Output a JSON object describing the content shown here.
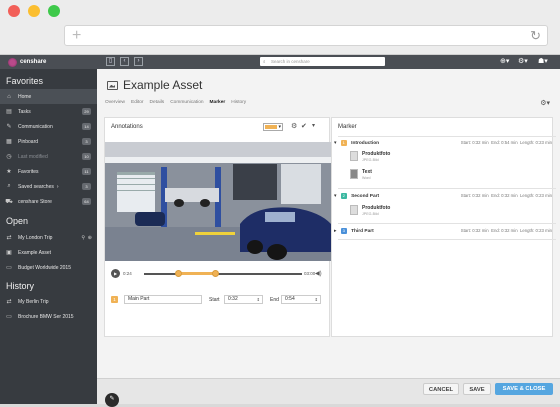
{
  "browser": {
    "colors": {
      "close": "#f25f58",
      "minimize": "#fbbe2f",
      "maximize": "#3ec94a"
    },
    "new_tab_icon": "plus-icon",
    "reload_icon": "reload-icon"
  },
  "app": {
    "brand": "censhare",
    "search_placeholder": "Search in censhare"
  },
  "sidebar": {
    "favorites_title": "Favorites",
    "favorites": [
      {
        "label": "Home",
        "icon": "home-icon",
        "badge": ""
      },
      {
        "label": "Tasks",
        "icon": "tasks-icon",
        "badge": "29"
      },
      {
        "label": "Communication",
        "icon": "communication-icon",
        "badge": "14"
      },
      {
        "label": "Pinboard",
        "icon": "pinboard-icon",
        "badge": "3"
      },
      {
        "label": "Last modified",
        "icon": "clock-icon",
        "badge": "10"
      },
      {
        "label": "Favorites",
        "icon": "star-icon",
        "badge": "11"
      },
      {
        "label": "Saved searches",
        "icon": "search-icon",
        "badge": "3"
      },
      {
        "label": "censhare Store",
        "icon": "store-icon",
        "badge": "64"
      }
    ],
    "open_title": "Open",
    "open": [
      {
        "label": "My London Trip",
        "icon": "link-icon"
      },
      {
        "label": "Example Asset",
        "icon": "image-icon"
      },
      {
        "label": "Budget Worldwide 2015",
        "icon": "document-icon"
      }
    ],
    "history_title": "History",
    "history": [
      {
        "label": "My Berlin Trip",
        "icon": "link-icon"
      },
      {
        "label": "Brochure BMW Ser 2015",
        "icon": "document-icon"
      }
    ]
  },
  "main": {
    "title": "Example Asset",
    "tabs": [
      "Overview",
      "Editor",
      "Details",
      "Communication",
      "Marker",
      "History"
    ],
    "active_tab": "Marker"
  },
  "annotations": {
    "title": "Annotations",
    "time_start": "0:24",
    "time_end": "03:00",
    "playhead_fraction": 0.45,
    "segment_start_fraction": 0.22,
    "segment_end_fraction": 0.45,
    "part_number": "1",
    "part_name": "Main Part",
    "start_label": "Start",
    "start_value": "0:32",
    "end_label": "End",
    "end_value": "0:54",
    "accent": "#f0b255"
  },
  "marker": {
    "title": "Marker",
    "parts": [
      {
        "num": "1",
        "name": "Introduction",
        "color": "#f0b255",
        "start": "Start: 0:32 min",
        "end": "End: 0:54 min",
        "length": "Length: 0:23 min",
        "items": [
          {
            "title": "Produktfoto",
            "sub": "JPEG-Bild"
          },
          {
            "title": "Text",
            "sub": "Word"
          }
        ]
      },
      {
        "num": "2",
        "name": "Second Part",
        "color": "#3bb8a1",
        "start": "Start: 0:32 min",
        "end": "End: 0:32 min",
        "length": "Length: 0:23 min",
        "items": [
          {
            "title": "Produktfoto",
            "sub": "JPEG-Bild"
          }
        ]
      },
      {
        "num": "3",
        "name": "Third Part",
        "color": "#4a90d9",
        "start": "Start: 0:32 min",
        "end": "End: 0:32 min",
        "length": "Length: 0:23 min",
        "items": []
      }
    ]
  },
  "footer": {
    "cancel": "CANCEL",
    "save": "SAVE",
    "save_close": "SAVE & CLOSE"
  }
}
